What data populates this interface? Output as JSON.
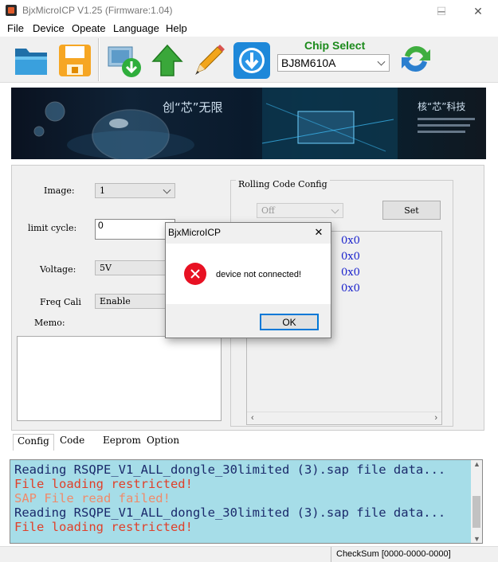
{
  "window": {
    "title": "BjxMicroICP V1.25 (Firmware:1.04)",
    "minimize": "─",
    "maximize": "☐",
    "close": "✕"
  },
  "menu": [
    "File",
    "Device",
    "Opeate",
    "Language",
    "Help"
  ],
  "toolbar": {
    "chip_select_label": "Chip Select",
    "chip_value": "BJ8M610A",
    "icons": [
      "folder-icon",
      "save-icon",
      "download-image-icon",
      "upload-arrow-icon",
      "edit-pencil-icon",
      "download-circle-icon",
      "refresh-icon"
    ]
  },
  "config": {
    "image_label": "Image:",
    "image_value": "1",
    "limit_cycle_label": "limit cycle:",
    "limit_cycle_value": "0",
    "voltage_label": "Voltage:",
    "voltage_value": "5V",
    "freq_cali_label": "Freq Cali",
    "freq_cali_value": "Enable",
    "memo_label": "Memo:"
  },
  "rolling_code": {
    "title": "Rolling Code Config",
    "mode_value": "Off",
    "set_label": "Set",
    "values": [
      "0x0",
      "0x0",
      "0x0",
      "0x0"
    ]
  },
  "tabs": [
    "Config",
    "Code",
    "Eeprom",
    "Option"
  ],
  "log": [
    {
      "text": "Reading RSQPE_V1_ALL_dongle_30limited (3).sap file data...",
      "color": "#1b2a6b"
    },
    {
      "text": "File loading restricted!",
      "color": "#e0402a"
    },
    {
      "text": "SAP File read failed!",
      "color": "#f08a6a"
    },
    {
      "text": "Reading RSQPE_V1_ALL_dongle_30limited (3).sap file data...",
      "color": "#1b2a6b"
    },
    {
      "text": "File loading restricted!",
      "color": "#e0402a"
    }
  ],
  "status": {
    "checksum": "CheckSum [0000-0000-0000]"
  },
  "dialog": {
    "title": "BjxMicroICP",
    "close": "✕",
    "message": "device not connected!",
    "ok_label": "OK"
  }
}
